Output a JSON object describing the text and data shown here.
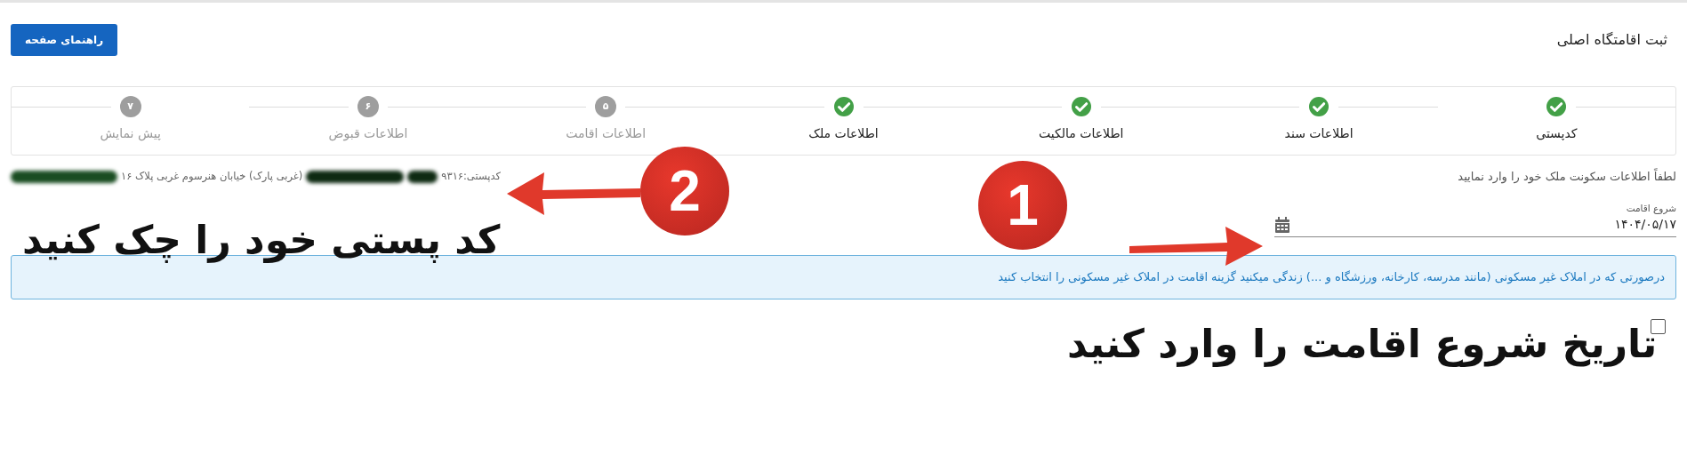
{
  "header": {
    "title": "ثبت اقامتگاه اصلی",
    "help_button": "راهنمای صفحه"
  },
  "steps": [
    {
      "label": "کدپستی",
      "done": true
    },
    {
      "label": "اطلاعات سند",
      "done": true
    },
    {
      "label": "اطلاعات مالکیت",
      "done": true
    },
    {
      "label": "اطلاعات ملک",
      "done": true
    },
    {
      "label": "اطلاعات اقامت",
      "done": false,
      "number": "۵"
    },
    {
      "label": "اطلاعات قبوض",
      "done": false,
      "number": "۶"
    },
    {
      "label": "پیش نمایش",
      "done": false,
      "number": "۷"
    }
  ],
  "instruction": "لطفاً اطلاعات سکونت ملک خود را وارد نمایید",
  "postal_info": {
    "label": "کدپستی:۹۳۱۶",
    "address": "(غربی پارک) خیابان هنرسوم غربی پلاک ۱۶"
  },
  "start_date": {
    "label": "شروع اقامت",
    "value": "۱۴۰۴/۰۵/۱۷"
  },
  "alert": "درصورتی که در املاک غیر مسکونی (مانند مدرسه، کارخانه، ورزشگاه و ...) زندگی میکنید گزینه اقامت در املاک غیر مسکونی را انتخاب کنید",
  "non_residential_checkbox": {
    "checked": false
  },
  "annotations": {
    "marker_1": "1",
    "caption_1": "تاریخ شروع اقامت را وارد کنید",
    "marker_2": "2",
    "caption_2": "کد پستی خود را چک کنید"
  }
}
